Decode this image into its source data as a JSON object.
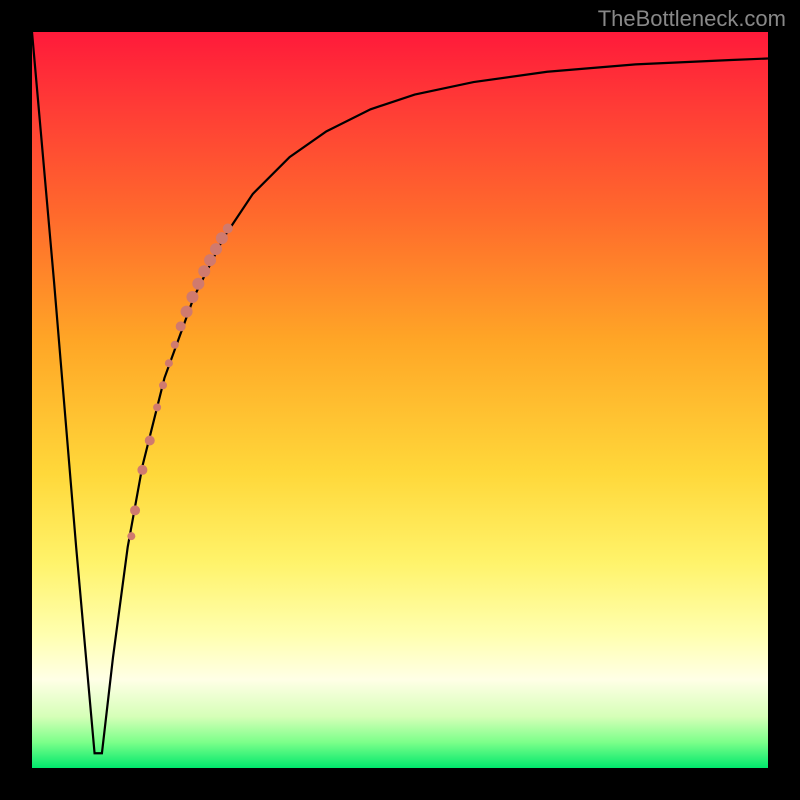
{
  "watermark": "TheBottleneck.com",
  "chart_data": {
    "type": "line",
    "title": "",
    "xlabel": "",
    "ylabel": "",
    "xlim": [
      0,
      100
    ],
    "ylim": [
      0,
      100
    ],
    "curve": {
      "name": "bottleneck-curve",
      "x": [
        0,
        3,
        6,
        8.5,
        9.5,
        11,
        13,
        15,
        18,
        22,
        26,
        30,
        35,
        40,
        46,
        52,
        60,
        70,
        82,
        95,
        100
      ],
      "y": [
        100,
        66,
        30,
        2,
        2,
        15,
        30,
        41,
        53,
        64,
        72,
        78,
        83,
        86.5,
        89.5,
        91.5,
        93.2,
        94.6,
        95.6,
        96.2,
        96.4
      ]
    },
    "series": [
      {
        "name": "pink-markers",
        "type": "scatter",
        "points": [
          {
            "x": 17.0,
            "y": 49.0,
            "r": 4
          },
          {
            "x": 17.8,
            "y": 52.0,
            "r": 4
          },
          {
            "x": 18.6,
            "y": 55.0,
            "r": 4
          },
          {
            "x": 19.4,
            "y": 57.5,
            "r": 4
          },
          {
            "x": 20.2,
            "y": 60.0,
            "r": 5
          },
          {
            "x": 21.0,
            "y": 62.0,
            "r": 6
          },
          {
            "x": 21.8,
            "y": 64.0,
            "r": 6
          },
          {
            "x": 22.6,
            "y": 65.8,
            "r": 6
          },
          {
            "x": 23.4,
            "y": 67.5,
            "r": 6
          },
          {
            "x": 24.2,
            "y": 69.0,
            "r": 6
          },
          {
            "x": 25.0,
            "y": 70.5,
            "r": 6
          },
          {
            "x": 25.8,
            "y": 72.0,
            "r": 6
          },
          {
            "x": 26.6,
            "y": 73.3,
            "r": 5
          },
          {
            "x": 16.0,
            "y": 44.5,
            "r": 5
          },
          {
            "x": 15.0,
            "y": 40.5,
            "r": 5
          },
          {
            "x": 14.0,
            "y": 35.0,
            "r": 5
          },
          {
            "x": 13.5,
            "y": 31.5,
            "r": 4
          }
        ]
      }
    ],
    "gradient_stops": [
      {
        "pos": 0.0,
        "color": "#ff1a3a"
      },
      {
        "pos": 0.1,
        "color": "#ff3b36"
      },
      {
        "pos": 0.25,
        "color": "#ff6a2c"
      },
      {
        "pos": 0.42,
        "color": "#ffa626"
      },
      {
        "pos": 0.6,
        "color": "#ffd83a"
      },
      {
        "pos": 0.72,
        "color": "#fff36a"
      },
      {
        "pos": 0.82,
        "color": "#ffffb0"
      },
      {
        "pos": 0.88,
        "color": "#ffffe6"
      },
      {
        "pos": 0.93,
        "color": "#d6ffb8"
      },
      {
        "pos": 0.965,
        "color": "#7cff8a"
      },
      {
        "pos": 1.0,
        "color": "#00e86c"
      }
    ]
  }
}
